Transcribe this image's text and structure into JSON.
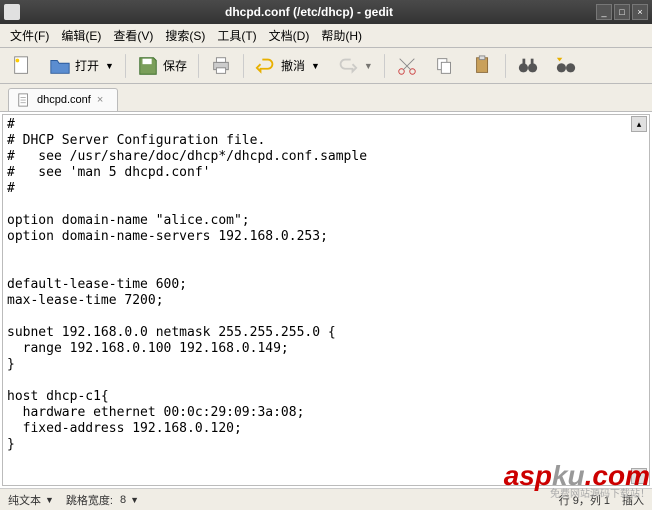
{
  "window": {
    "title": "dhcpd.conf (/etc/dhcp) - gedit"
  },
  "menu": {
    "file": "文件(F)",
    "edit": "编辑(E)",
    "view": "查看(V)",
    "search": "搜索(S)",
    "tools": "工具(T)",
    "documents": "文档(D)",
    "help": "帮助(H)"
  },
  "toolbar": {
    "open": "打开",
    "save": "保存",
    "undo": "撤消"
  },
  "tab": {
    "name": "dhcpd.conf"
  },
  "content": "#\n# DHCP Server Configuration file.\n#   see /usr/share/doc/dhcp*/dhcpd.conf.sample\n#   see 'man 5 dhcpd.conf'\n#\n\noption domain-name \"alice.com\";\noption domain-name-servers 192.168.0.253;\n\n\ndefault-lease-time 600;\nmax-lease-time 7200;\n\nsubnet 192.168.0.0 netmask 255.255.255.0 {\n  range 192.168.0.100 192.168.0.149;\n}\n\nhost dhcp-c1{\n  hardware ethernet 00:0c:29:09:3a:08;\n  fixed-address 192.168.0.120;\n}\n",
  "status": {
    "syntax": "纯文本",
    "tabwidth_label": "跳格宽度:",
    "tabwidth_value": "8",
    "position": "行 9，列 1",
    "insert": "插入"
  },
  "watermark": {
    "brand_a": "asp",
    "brand_b": "ku",
    "brand_c": ".com",
    "tagline": "免费网站源码下载站！"
  }
}
